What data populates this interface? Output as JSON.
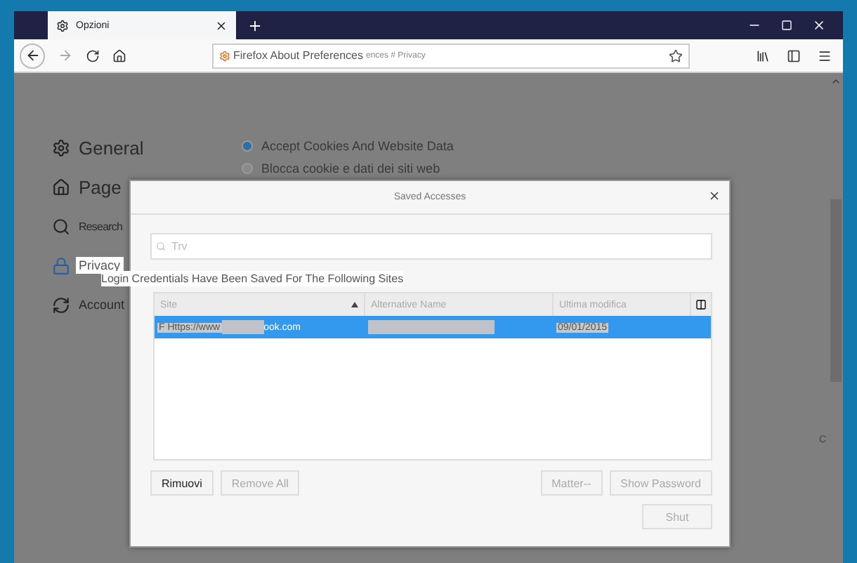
{
  "tabs": [
    {
      "label": "Opzioni",
      "selected": true
    }
  ],
  "address_bar": {
    "value": "Firefox About Preferences",
    "suffix": "ences # Privacy"
  },
  "sidebar": {
    "items": [
      {
        "label": "General",
        "selected": false
      },
      {
        "label": "Page",
        "selected": false
      },
      {
        "label": "Research",
        "selected": false
      },
      {
        "label": "Privacy",
        "selected": true
      },
      {
        "label": "Account",
        "selected": false
      }
    ]
  },
  "cookie_options": [
    {
      "label": "Accept Cookies And Website Data",
      "selected": true
    },
    {
      "label": "Blocca cookie e dati dei siti web",
      "selected": false
    }
  ],
  "edge_text": "C",
  "dialog": {
    "title": "Saved Accesses",
    "search": {
      "placeholder": "Trv"
    },
    "caption": "Login Credentials Have Been Saved For The Following Sites",
    "table": {
      "columns": [
        "Site",
        "Alternative Name",
        "Ultima modifica"
      ],
      "rows": [
        {
          "site_start": "F Https://www",
          "site_end": "ook.com",
          "date": "09/01/2015",
          "selected": true
        }
      ]
    },
    "buttons": [
      {
        "label": "Rimuovi",
        "disabled": false
      },
      {
        "label": "Remove All",
        "disabled": true
      }
    ],
    "right_buttons": [
      {
        "label": "Matter--",
        "disabled": true
      },
      {
        "label": "Show Password",
        "disabled": true
      }
    ],
    "close_button": {
      "label": "Shut",
      "disabled": true
    }
  }
}
